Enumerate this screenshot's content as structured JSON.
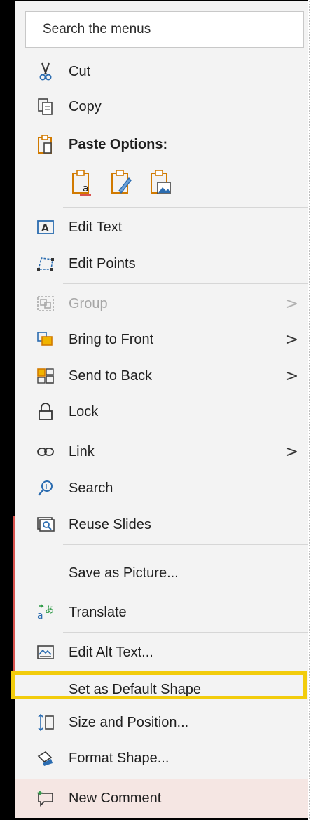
{
  "search": {
    "placeholder": "Search the menus"
  },
  "items": {
    "cut": "Cut",
    "copy": "Copy",
    "paste_options": "Paste Options:",
    "edit_text": "Edit Text",
    "edit_points": "Edit Points",
    "group": "Group",
    "bring_to_front": "Bring to Front",
    "send_to_back": "Send to Back",
    "lock": "Lock",
    "link": "Link",
    "search": "Search",
    "reuse_slides": "Reuse Slides",
    "save_as_picture": "Save as Picture...",
    "translate": "Translate",
    "edit_alt_text": "Edit Alt Text...",
    "set_default_shape": "Set as Default Shape",
    "size_and_position": "Size and Position...",
    "format_shape": "Format Shape...",
    "new_comment": "New Comment"
  },
  "submenu_arrow": ">",
  "colors": {
    "menu_bg": "#f3f3f3",
    "accent_orange": "#d17a00",
    "accent_blue": "#2b6cb0",
    "highlight_border": "#f2cc0c",
    "hover_bg": "#f5e6e3"
  },
  "icons": [
    "scissors-icon",
    "copy-icon",
    "paste-icon",
    "paste-text-icon",
    "paste-format-icon",
    "paste-picture-icon",
    "edit-text-icon",
    "edit-points-icon",
    "group-icon",
    "bring-to-front-icon",
    "send-to-back-icon",
    "lock-icon",
    "link-icon",
    "search-icon",
    "reuse-slides-icon",
    "translate-icon",
    "alt-text-icon",
    "size-position-icon",
    "format-shape-icon",
    "comment-icon"
  ]
}
